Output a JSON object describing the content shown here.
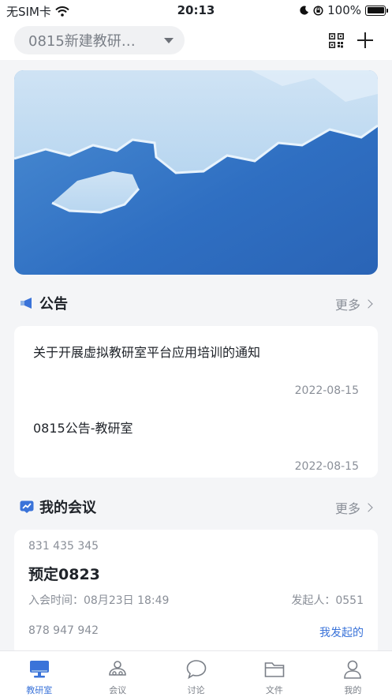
{
  "status_bar": {
    "carrier": "无SIM卡",
    "time": "20:13",
    "battery": "100%"
  },
  "header": {
    "room_name": "0815新建教研…"
  },
  "announcements": {
    "title": "公告",
    "more_label": "更多",
    "items": [
      {
        "title": "关于开展虚拟教研室平台应用培训的通知",
        "date": "2022-08-15"
      },
      {
        "title": "0815公告-教研室",
        "date": "2022-08-15"
      }
    ]
  },
  "meetings": {
    "title": "我的会议",
    "more_label": "更多",
    "items": [
      {
        "id": "831 435 345",
        "name": "预定0823",
        "time_label": "入会时间：",
        "time": "08月23日 18:49",
        "initiator_label": "发起人：",
        "initiator": "0551"
      },
      {
        "id": "878 947 942",
        "tag": "我发起的"
      }
    ]
  },
  "tab_bar": {
    "tabs": [
      {
        "label": "教研室",
        "active": true
      },
      {
        "label": "会议"
      },
      {
        "label": "讨论"
      },
      {
        "label": "文件"
      },
      {
        "label": "我的"
      }
    ]
  },
  "colors": {
    "accent": "#3a73d9",
    "background": "#f4f5f7"
  }
}
